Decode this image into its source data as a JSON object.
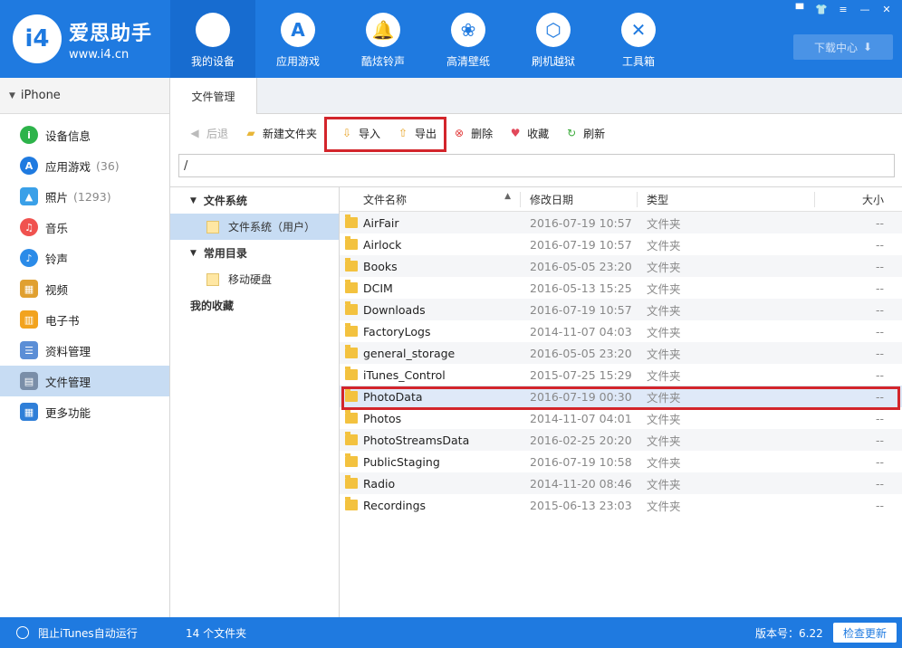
{
  "header": {
    "logo_text": "爱思助手",
    "logo_url": "www.i4.cn",
    "logo_badge": "i4",
    "nav": [
      {
        "label": "我的设备",
        "icon": ""
      },
      {
        "label": "应用游戏",
        "icon": "A"
      },
      {
        "label": "酷炫铃声",
        "icon": "🔔"
      },
      {
        "label": "高清壁纸",
        "icon": "❀"
      },
      {
        "label": "刷机越狱",
        "icon": "⬡"
      },
      {
        "label": "工具箱",
        "icon": "✕"
      }
    ],
    "download_label": "下载中心",
    "download_icon": "⬇"
  },
  "window_controls": [
    "▀",
    "👕",
    "≡",
    "—",
    "✕"
  ],
  "sidebar": {
    "device_name": "iPhone",
    "items": [
      {
        "label": "设备信息",
        "count": "",
        "icon": "i",
        "color": "#2db34a"
      },
      {
        "label": "应用游戏",
        "count": "(36)",
        "icon": "A",
        "color": "#1f7ae0"
      },
      {
        "label": "照片",
        "count": "(1293)",
        "icon": "▲",
        "color": "#3aa0e8"
      },
      {
        "label": "音乐",
        "count": "",
        "icon": "♫",
        "color": "#f0524f"
      },
      {
        "label": "铃声",
        "count": "",
        "icon": "♪",
        "color": "#2b8be8"
      },
      {
        "label": "视频",
        "count": "",
        "icon": "▦",
        "color": "#e0a030"
      },
      {
        "label": "电子书",
        "count": "",
        "icon": "▥",
        "color": "#f2a31e"
      },
      {
        "label": "资料管理",
        "count": "",
        "icon": "☰",
        "color": "#5b8ed6"
      },
      {
        "label": "文件管理",
        "count": "",
        "icon": "▤",
        "color": "#7a8ea8"
      },
      {
        "label": "更多功能",
        "count": "",
        "icon": "▦",
        "color": "#2f7fd8"
      }
    ]
  },
  "tab": {
    "label": "文件管理"
  },
  "toolbar": {
    "back": "后退",
    "new_folder": "新建文件夹",
    "import": "导入",
    "export": "导出",
    "delete": "删除",
    "favorite": "收藏",
    "refresh": "刷新"
  },
  "path": "/",
  "tree": {
    "group1": "文件系统",
    "group1_child": "文件系统（用户）",
    "group2": "常用目录",
    "group2_child": "移动硬盘",
    "group3": "我的收藏"
  },
  "filelist": {
    "columns": {
      "name": "文件名称",
      "date": "修改日期",
      "type": "类型",
      "size": "大小"
    },
    "rows": [
      {
        "name": "AirFair",
        "date": "2016-07-19 10:57",
        "type": "文件夹",
        "size": "--"
      },
      {
        "name": "Airlock",
        "date": "2016-07-19 10:57",
        "type": "文件夹",
        "size": "--"
      },
      {
        "name": "Books",
        "date": "2016-05-05 23:20",
        "type": "文件夹",
        "size": "--"
      },
      {
        "name": "DCIM",
        "date": "2016-05-13 15:25",
        "type": "文件夹",
        "size": "--"
      },
      {
        "name": "Downloads",
        "date": "2016-07-19 10:57",
        "type": "文件夹",
        "size": "--"
      },
      {
        "name": "FactoryLogs",
        "date": "2014-11-07 04:03",
        "type": "文件夹",
        "size": "--"
      },
      {
        "name": "general_storage",
        "date": "2016-05-05 23:20",
        "type": "文件夹",
        "size": "--"
      },
      {
        "name": "iTunes_Control",
        "date": "2015-07-25 15:29",
        "type": "文件夹",
        "size": "--"
      },
      {
        "name": "PhotoData",
        "date": "2016-07-19 00:30",
        "type": "文件夹",
        "size": "--"
      },
      {
        "name": "Photos",
        "date": "2014-11-07 04:01",
        "type": "文件夹",
        "size": "--"
      },
      {
        "name": "PhotoStreamsData",
        "date": "2016-02-25 20:20",
        "type": "文件夹",
        "size": "--"
      },
      {
        "name": "PublicStaging",
        "date": "2016-07-19 10:58",
        "type": "文件夹",
        "size": "--"
      },
      {
        "name": "Radio",
        "date": "2014-11-20 08:46",
        "type": "文件夹",
        "size": "--"
      },
      {
        "name": "Recordings",
        "date": "2015-06-13 23:03",
        "type": "文件夹",
        "size": "--"
      }
    ]
  },
  "statusbar": {
    "itunes_label": "阻止iTunes自动运行",
    "count_label": "14 个文件夹",
    "version_label": "版本号：6.22",
    "update_label": "检查更新"
  },
  "colors": {
    "accent": "#1f7ae0",
    "highlight": "#d3252b",
    "selection": "#c7dcf3"
  }
}
